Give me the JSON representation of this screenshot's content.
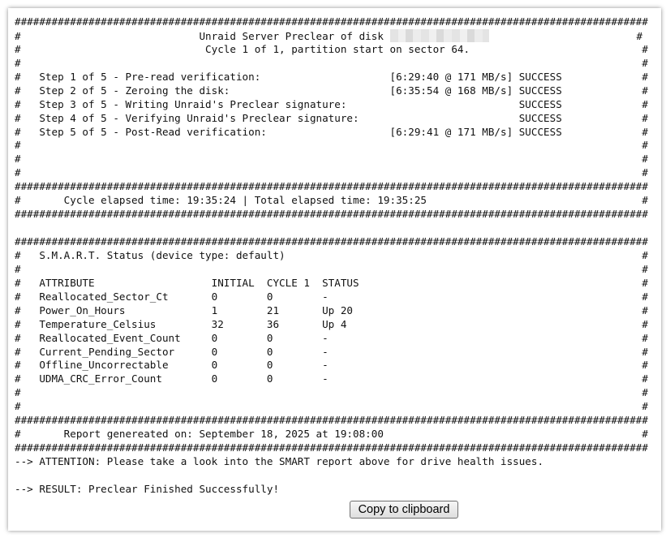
{
  "report": {
    "lines": [
      "#######################################################################################################",
      "#                             Unraid Server Preclear of disk                                          #",
      "#                              Cycle 1 of 1, partition start on sector 64.                            #",
      "#                                                                                                     #",
      "#   Step 1 of 5 - Pre-read verification:                     [6:29:40 @ 171 MB/s] SUCCESS             #",
      "#   Step 2 of 5 - Zeroing the disk:                          [6:35:54 @ 168 MB/s] SUCCESS             #",
      "#   Step 3 of 5 - Writing Unraid's Preclear signature:                            SUCCESS             #",
      "#   Step 4 of 5 - Verifying Unraid's Preclear signature:                          SUCCESS             #",
      "#   Step 5 of 5 - Post-Read verification:                    [6:29:41 @ 171 MB/s] SUCCESS             #",
      "#                                                                                                     #",
      "#                                                                                                     #",
      "#                                                                                                     #",
      "#######################################################################################################",
      "#       Cycle elapsed time: 19:35:24 | Total elapsed time: 19:35:25                                   #",
      "#######################################################################################################",
      "",
      "#######################################################################################################",
      "#   S.M.A.R.T. Status (device type: default)                                                          #",
      "#                                                                                                     #",
      "#   ATTRIBUTE                   INITIAL  CYCLE 1  STATUS                                              #",
      "#   Reallocated_Sector_Ct       0        0        -                                                   #",
      "#   Power_On_Hours              1        21       Up 20                                               #",
      "#   Temperature_Celsius         32       36       Up 4                                                #",
      "#   Reallocated_Event_Count     0        0        -                                                   #",
      "#   Current_Pending_Sector      0        0        -                                                   #",
      "#   Offline_Uncorrectable       0        0        -                                                   #",
      "#   UDMA_CRC_Error_Count        0        0        -                                                   #",
      "#                                                                                                     #",
      "#                                                                                                     #",
      "#######################################################################################################",
      "#       Report genereated on: September 18, 2025 at 19:08:00                                          #",
      "#######################################################################################################",
      "--> ATTENTION: Please take a look into the SMART report above for drive health issues.",
      "",
      "--> RESULT: Preclear Finished Successfully!"
    ]
  },
  "copy_button": {
    "label": "Copy to clipboard"
  }
}
